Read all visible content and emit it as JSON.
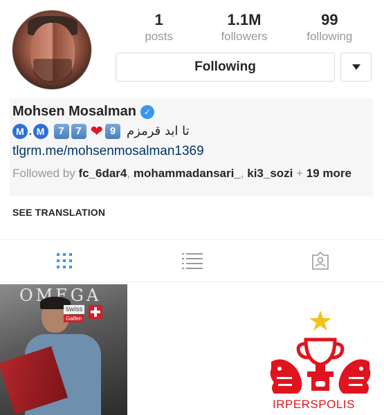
{
  "profile": {
    "stats": [
      {
        "value": "1",
        "label": "posts"
      },
      {
        "value": "1.1M",
        "label": "followers"
      },
      {
        "value": "99",
        "label": "following"
      }
    ],
    "follow_button": "Following",
    "name": "Mohsen Mosalman",
    "verified_mark": "✓",
    "bio": {
      "m1": "M",
      "dot": ".",
      "m2": "M",
      "key1": "7",
      "key2": "7",
      "heart": "❤",
      "key3": "9",
      "persian_text": "تا ابد قرمزم"
    },
    "link": "tlgrm.me/mohsenmosalman1369",
    "followed_by": {
      "prefix": "Followed by ",
      "user1": "fc_6dar4",
      "sep1": ", ",
      "user2": "mohammadansari_",
      "sep2": ", ",
      "user3": "ki3_sozi",
      "plus": " + ",
      "more": "19 more"
    },
    "see_translation": "SEE TRANSLATION"
  },
  "posts": {
    "post1_brand": "OMEGA",
    "post1_swiss": "swiss",
    "post1_gallen": "Gallen",
    "post3_logo_text": "IRPERSPOLIS"
  },
  "colors": {
    "accent": "#3897f0",
    "link": "#003569",
    "grid_active": "#3897f0",
    "icon_inactive": "#999999",
    "perspolis_red": "#e0141e",
    "star_gold": "#f2c21b"
  }
}
